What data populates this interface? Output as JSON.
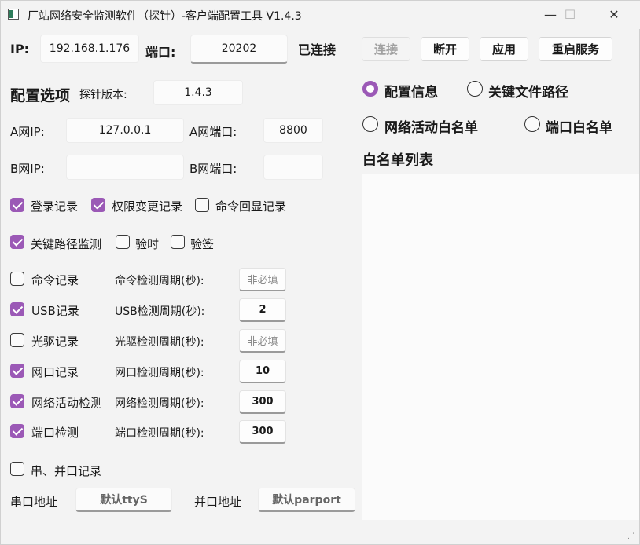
{
  "window": {
    "title": "厂站网络安全监测软件（探针）-客户端配置工具 V1.4.3",
    "minimize": "—",
    "maximize": "☐",
    "close": "✕"
  },
  "connection": {
    "ip_label": "IP:",
    "ip_value": "192.168.1.176",
    "port_label": "端口:",
    "port_value": "20202",
    "status": "已连接",
    "connect_button": "连接",
    "disconnect_button": "断开",
    "apply_button": "应用",
    "restart_button": "重启服务"
  },
  "config": {
    "section_title": "配置选项",
    "probe_version_label": "探针版本:",
    "probe_version_value": "1.4.3",
    "a_ip_label": "A网IP:",
    "a_ip_value": "127.0.0.1",
    "a_port_label": "A网端口:",
    "a_port_value": "8800",
    "b_ip_label": "B网IP:",
    "b_ip_value": "",
    "b_port_label": "B网端口:",
    "b_port_value": ""
  },
  "checkboxes": {
    "login_record": {
      "label": "登录记录",
      "checked": true
    },
    "permission_change": {
      "label": "权限变更记录",
      "checked": true
    },
    "command_echo": {
      "label": "命令回显记录",
      "checked": false
    },
    "key_path_monitor": {
      "label": "关键路径监测",
      "checked": true
    },
    "timing_check": {
      "label": "验时",
      "checked": false
    },
    "signature_check": {
      "label": "验签",
      "checked": false
    }
  },
  "monitors": [
    {
      "label": "命令记录",
      "checked": false,
      "period_label": "命令检测周期(秒):",
      "period_value": "非必填",
      "placeholder": true
    },
    {
      "label": "USB记录",
      "checked": true,
      "period_label": "USB检测周期(秒):",
      "period_value": "2",
      "placeholder": false
    },
    {
      "label": "光驱记录",
      "checked": false,
      "period_label": "光驱检测周期(秒):",
      "period_value": "非必填",
      "placeholder": true
    },
    {
      "label": "网口记录",
      "checked": true,
      "period_label": "网口检测周期(秒):",
      "period_value": "10",
      "placeholder": false
    },
    {
      "label": "网络活动检测",
      "checked": true,
      "period_label": "网络检测周期(秒):",
      "period_value": "300",
      "placeholder": false
    },
    {
      "label": "端口检测",
      "checked": true,
      "period_label": "端口检测周期(秒):",
      "period_value": "300",
      "placeholder": false
    }
  ],
  "serial": {
    "checkbox_label": "串、并口记录",
    "checked": false,
    "serial_addr_label": "串口地址",
    "serial_addr_value": "默认ttyS",
    "parallel_addr_label": "并口地址",
    "parallel_addr_value": "默认parport"
  },
  "right_panel": {
    "radios": [
      {
        "label": "配置信息",
        "checked": true
      },
      {
        "label": "关键文件路径",
        "checked": false
      },
      {
        "label": "网络活动白名单",
        "checked": false
      },
      {
        "label": "端口白名单",
        "checked": false
      }
    ],
    "whitelist_title": "白名单列表"
  },
  "colors": {
    "accent": "#9b59b6",
    "window_bg": "#f3f3f3"
  },
  "icons": {
    "app": "app-window-icon",
    "resize": "resize-grip-icon"
  }
}
